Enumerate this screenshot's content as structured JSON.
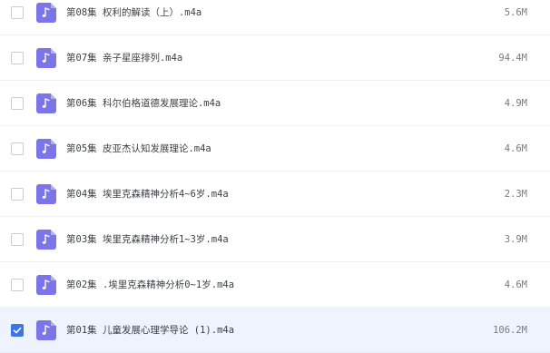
{
  "files": [
    {
      "name": "第08集 权利的解读（上）.m4a",
      "size": "5.6M",
      "selected": false,
      "icon": "music-note-icon"
    },
    {
      "name": "第07集 亲子星座排列.m4a",
      "size": "94.4M",
      "selected": false,
      "icon": "music-note-icon"
    },
    {
      "name": "第06集 科尔伯格道德发展理论.m4a",
      "size": "4.9M",
      "selected": false,
      "icon": "music-note-icon"
    },
    {
      "name": "第05集 皮亚杰认知发展理论.m4a",
      "size": "4.6M",
      "selected": false,
      "icon": "music-note-icon"
    },
    {
      "name": "第04集 埃里克森精神分析4~6岁.m4a",
      "size": "2.3M",
      "selected": false,
      "icon": "music-note-icon"
    },
    {
      "name": "第03集 埃里克森精神分析1~3岁.m4a",
      "size": "3.9M",
      "selected": false,
      "icon": "music-note-icon"
    },
    {
      "name": "第02集 .埃里克森精神分析0~1岁.m4a",
      "size": "4.6M",
      "selected": false,
      "icon": "music-note-icon"
    },
    {
      "name": "第01集 儿童发展心理学导论 (1).m4a",
      "size": "106.2M",
      "selected": true,
      "icon": "music-note-icon"
    }
  ],
  "colors": {
    "icon_background": "#7c74e9",
    "selected_row_background": "#eef3fd",
    "checkbox_checked": "#3a76e8"
  }
}
